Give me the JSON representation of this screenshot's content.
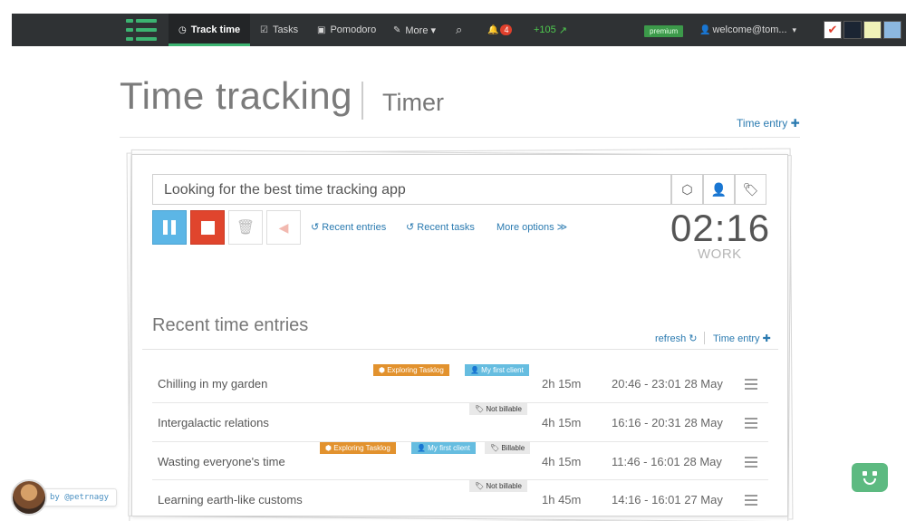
{
  "navbar": {
    "items": [
      {
        "icon": "clock-icon",
        "glyph": "◷",
        "label": "Track time"
      },
      {
        "icon": "check-square-icon",
        "glyph": "☑",
        "label": "Tasks"
      },
      {
        "icon": "gift-icon",
        "glyph": "▣",
        "label": "Pomodoro"
      },
      {
        "icon": "wrench-icon",
        "glyph": "✎",
        "label": "More ▾"
      }
    ],
    "search_glyph": "⌕",
    "notifications_glyph": "🔔",
    "notification_count": "4",
    "score": "+105",
    "score_arrow": "↗",
    "premium_label": "premium",
    "user_glyph": "👤",
    "user_label": "welcome@tom...",
    "user_caret": "▾",
    "swatch_check": "✔",
    "swatch_colors": [
      "#ffffff",
      "#1b2533",
      "#f0f2b8",
      "#8cb8e0"
    ]
  },
  "header": {
    "title": "Time tracking",
    "subtitle": "Timer",
    "time_entry_link": "Time entry ✚"
  },
  "timer": {
    "description": "Looking for the best time tracking app",
    "tool_glyphs": [
      "⬡",
      "👤",
      "🏷"
    ],
    "trash_glyph": "🗑",
    "sound_glyph": "◀",
    "recent_entries_link": "↺ Recent entries",
    "recent_tasks_link": "↺ Recent tasks",
    "more_options_link": "More options ≫",
    "clock": "02:16",
    "mode": "WORK"
  },
  "recent": {
    "title": "Recent time entries",
    "refresh_link": "refresh ↻",
    "time_entry_link": "Time entry ✚",
    "entries": [
      {
        "description": "Chilling in my garden",
        "duration": "2h 15m",
        "time": "20:46 - 23:01 28 May",
        "tags": {
          "project": "⬢ Exploring Tasklog",
          "client": "👤 My first client"
        }
      },
      {
        "description": "Intergalactic relations",
        "duration": "4h 15m",
        "time": "16:16 - 20:31 28 May",
        "tags": {
          "billable": "🏷 Not billable"
        }
      },
      {
        "description": "Wasting everyone's time",
        "duration": "4h 15m",
        "time": "11:46 - 16:01 28 May",
        "tags": {
          "project": "⬢ Exploring Tasklog",
          "client": "👤 My first client",
          "billable": "🏷 Billable"
        }
      },
      {
        "description": "Learning earth-like customs",
        "duration": "1h 45m",
        "time": "14:16 - 16:01 27 May",
        "tags": {
          "billable": "🏷 Not billable"
        }
      }
    ]
  },
  "credit": "by @petrnagy"
}
